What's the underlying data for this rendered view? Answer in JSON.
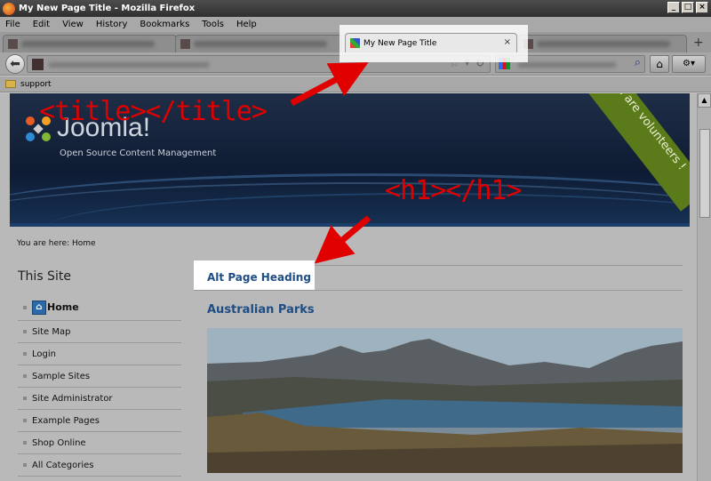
{
  "window": {
    "title": "My New Page Title - Mozilla Firefox"
  },
  "menu": [
    "File",
    "Edit",
    "View",
    "History",
    "Bookmarks",
    "Tools",
    "Help"
  ],
  "tabs": {
    "active_label": "My New Page Title",
    "close": "×",
    "new_tab": "+"
  },
  "bookmarks": {
    "folder_label": "support"
  },
  "banner": {
    "logo_text": "Joomla!",
    "tagline": "Open Source Content Management",
    "ribbon": "We are volunteers !"
  },
  "annotations": {
    "title_tag": "<title></title>",
    "h1_tag": "<h1></h1>"
  },
  "page": {
    "breadcrumb": "You are here: Home",
    "sidebar_heading": "This Site",
    "nav_items": [
      "Home",
      "Site Map",
      "Login",
      "Sample Sites",
      "Site Administrator",
      "Example Pages",
      "Shop Online",
      "All Categories"
    ],
    "alt_heading": "Alt Page Heading",
    "article_heading": "Australian Parks"
  },
  "colors": {
    "annotation": "#e00000",
    "heading": "#1e4d84"
  }
}
